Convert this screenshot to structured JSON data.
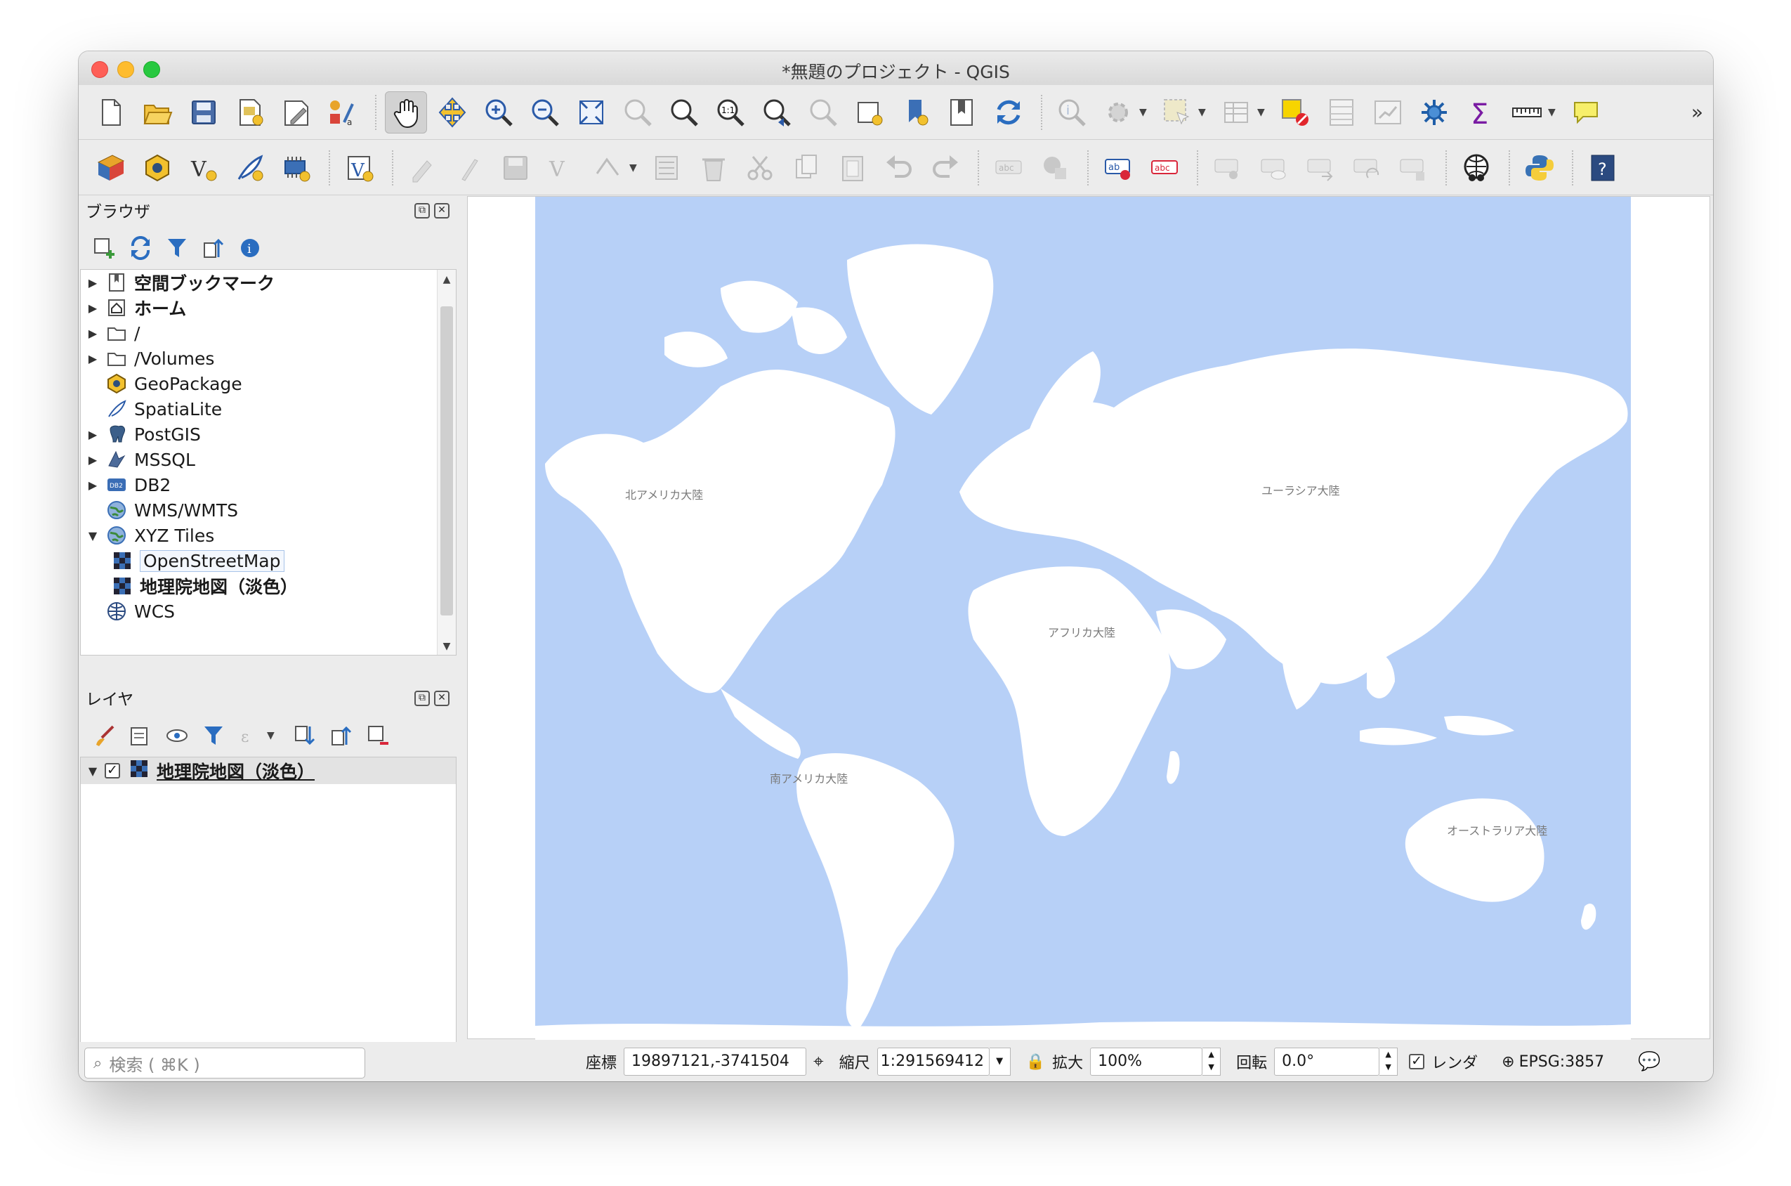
{
  "window": {
    "title": "*無題のプロジェクト - QGIS"
  },
  "toolbar_top": {
    "more_glyph": "»",
    "icons": [
      "new-project-icon",
      "open-project-icon",
      "save-project-icon",
      "new-print-layout-icon",
      "layout-manager-icon",
      "style-manager-icon",
      "pan-map-icon",
      "pan-to-selection-icon",
      "zoom-in-icon",
      "zoom-out-icon",
      "zoom-full-icon",
      "zoom-to-selection-icon",
      "zoom-to-layer-icon",
      "zoom-native-icon",
      "zoom-last-icon",
      "zoom-next-icon",
      "new-map-view-icon",
      "new-bookmark-icon",
      "show-bookmarks-icon",
      "refresh-icon",
      "identify-icon",
      "action-icon",
      "select-features-icon",
      "open-table-icon",
      "deselect-icon",
      "field-calculator-icon",
      "statistics-icon",
      "processing-toolbox-icon",
      "sum-icon",
      "measure-icon",
      "map-tips-icon"
    ]
  },
  "toolbar_second": {
    "icons": [
      "data-source-manager-icon",
      "new-geopackage-icon",
      "new-shapefile-icon",
      "new-spatialite-icon",
      "new-memory-layer-icon",
      "digitize-icon",
      "current-edits-icon",
      "toggle-editing-icon",
      "save-edits-icon",
      "add-feature-icon",
      "vertex-tool-icon",
      "modify-attributes-icon",
      "delete-selected-icon",
      "cut-icon",
      "copy-icon",
      "paste-icon",
      "undo-icon",
      "redo-icon",
      "label-toolbar-icon",
      "layer-diagram-icon",
      "label-highlight-icon",
      "label-abc-icon",
      "pin-labels-icon",
      "show-hide-labels-icon",
      "move-label-icon",
      "rotate-label-icon",
      "change-label-icon",
      "plugin-globe-icon",
      "python-console-icon",
      "help-icon"
    ]
  },
  "browser": {
    "title": "ブラウザ",
    "items": [
      {
        "label": "空間ブックマーク",
        "icon": "bookmark-icon",
        "expandable": true,
        "bold": true
      },
      {
        "label": "ホーム",
        "icon": "home-icon",
        "expandable": true,
        "bold": true
      },
      {
        "label": "/",
        "icon": "folder-icon",
        "expandable": true,
        "bold": false
      },
      {
        "label": "/Volumes",
        "icon": "folder-icon",
        "expandable": true,
        "bold": false
      },
      {
        "label": "GeoPackage",
        "icon": "geopackage-icon",
        "expandable": false,
        "bold": false
      },
      {
        "label": "SpatiaLite",
        "icon": "spatialite-icon",
        "expandable": false,
        "bold": false
      },
      {
        "label": "PostGIS",
        "icon": "postgis-icon",
        "expandable": true,
        "bold": false
      },
      {
        "label": "MSSQL",
        "icon": "mssql-icon",
        "expandable": true,
        "bold": false
      },
      {
        "label": "DB2",
        "icon": "db2-icon",
        "expandable": true,
        "bold": false
      },
      {
        "label": "WMS/WMTS",
        "icon": "wms-globe-icon",
        "expandable": false,
        "bold": false
      },
      {
        "label": "XYZ Tiles",
        "icon": "xyz-globe-icon",
        "expandable": true,
        "expanded": true,
        "bold": false
      },
      {
        "label": "OpenStreetMap",
        "icon": "xyz-tile-icon",
        "child": true,
        "selected": true
      },
      {
        "label": "地理院地図（淡色）",
        "icon": "xyz-tile-icon",
        "child": true,
        "bold": true
      },
      {
        "label": "WCS",
        "icon": "wcs-globe-icon",
        "expandable": false,
        "bold": false
      }
    ]
  },
  "layers": {
    "title": "レイヤ",
    "items": [
      {
        "label": "地理院地図（淡色）",
        "checked": true,
        "check_glyph": "✓"
      }
    ]
  },
  "map": {
    "labels": {
      "north_america": "北アメリカ大陸",
      "eurasia": "ユーラシア大陸",
      "africa": "アフリカ大陸",
      "south_america": "南アメリカ大陸",
      "australia": "オーストラリア大陸"
    },
    "colors": {
      "ocean": "#b7d0f7",
      "land": "#ffffff"
    }
  },
  "statusbar": {
    "search_placeholder": "検索 ( ⌘K )",
    "coordinate_label": "座標",
    "coordinate_value": "19897121,-3741504",
    "scale_label": "縮尺",
    "scale_value": "1:291569412",
    "magnifier_label": "拡大",
    "magnifier_value": "100%",
    "rotation_label": "回転",
    "rotation_value": "0.0°",
    "render_label": "レンダ",
    "render_checked": true,
    "crs": "EPSG:3857"
  }
}
